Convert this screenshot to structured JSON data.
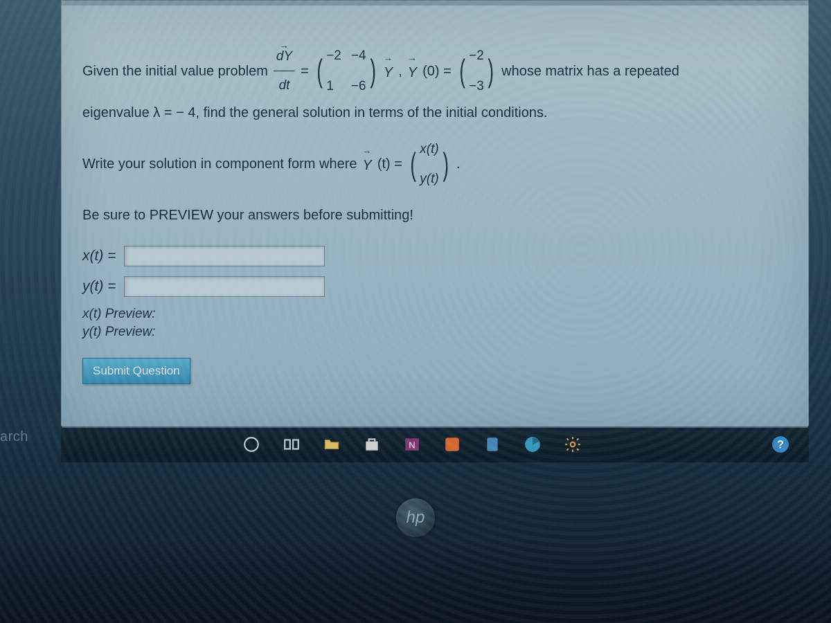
{
  "search_label": "arch",
  "problem": {
    "intro1": "Given the initial value problem",
    "frac_num": "dY",
    "frac_den": "dt",
    "eq": "=",
    "matrix": {
      "a11": "−2",
      "a12": "−4",
      "a21": "1",
      "a22": "−6"
    },
    "Yvec": "Y",
    "comma": ",",
    "Y0_left": "Y",
    "Y0_arg": "(0) =",
    "y0vec": {
      "r1": "−2",
      "r2": "−3"
    },
    "tail1": "whose matrix has a repeated",
    "line2a": "eigenvalue λ = − 4, find the general solution in terms of the initial conditions.",
    "line3a": "Write your solution in component form where",
    "Yt": "Y",
    "Yt_arg": "(t) =",
    "compvec": {
      "r1": "x(t)",
      "r2": "y(t)"
    },
    "period": ".",
    "preview_hint": "Be sure to PREVIEW your answers before submitting!"
  },
  "answers": {
    "xt_label": "x(t) =",
    "yt_label": "y(t) =",
    "xt_value": "",
    "yt_value": "",
    "xt_preview": "x(t) Preview:",
    "yt_preview": "y(t) Preview:"
  },
  "submit_label": "Submit Question",
  "hp": "hp"
}
